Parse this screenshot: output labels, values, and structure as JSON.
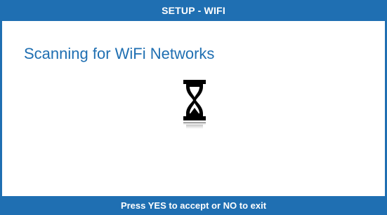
{
  "header": {
    "title": "SETUP - WIFI"
  },
  "main": {
    "status_text": "Scanning for WiFi Networks",
    "icon": "hourglass-icon"
  },
  "footer": {
    "instruction": "Press YES to accept or NO to exit"
  },
  "colors": {
    "accent": "#1f6fb2",
    "background": "#ffffff",
    "icon": "#000000"
  }
}
